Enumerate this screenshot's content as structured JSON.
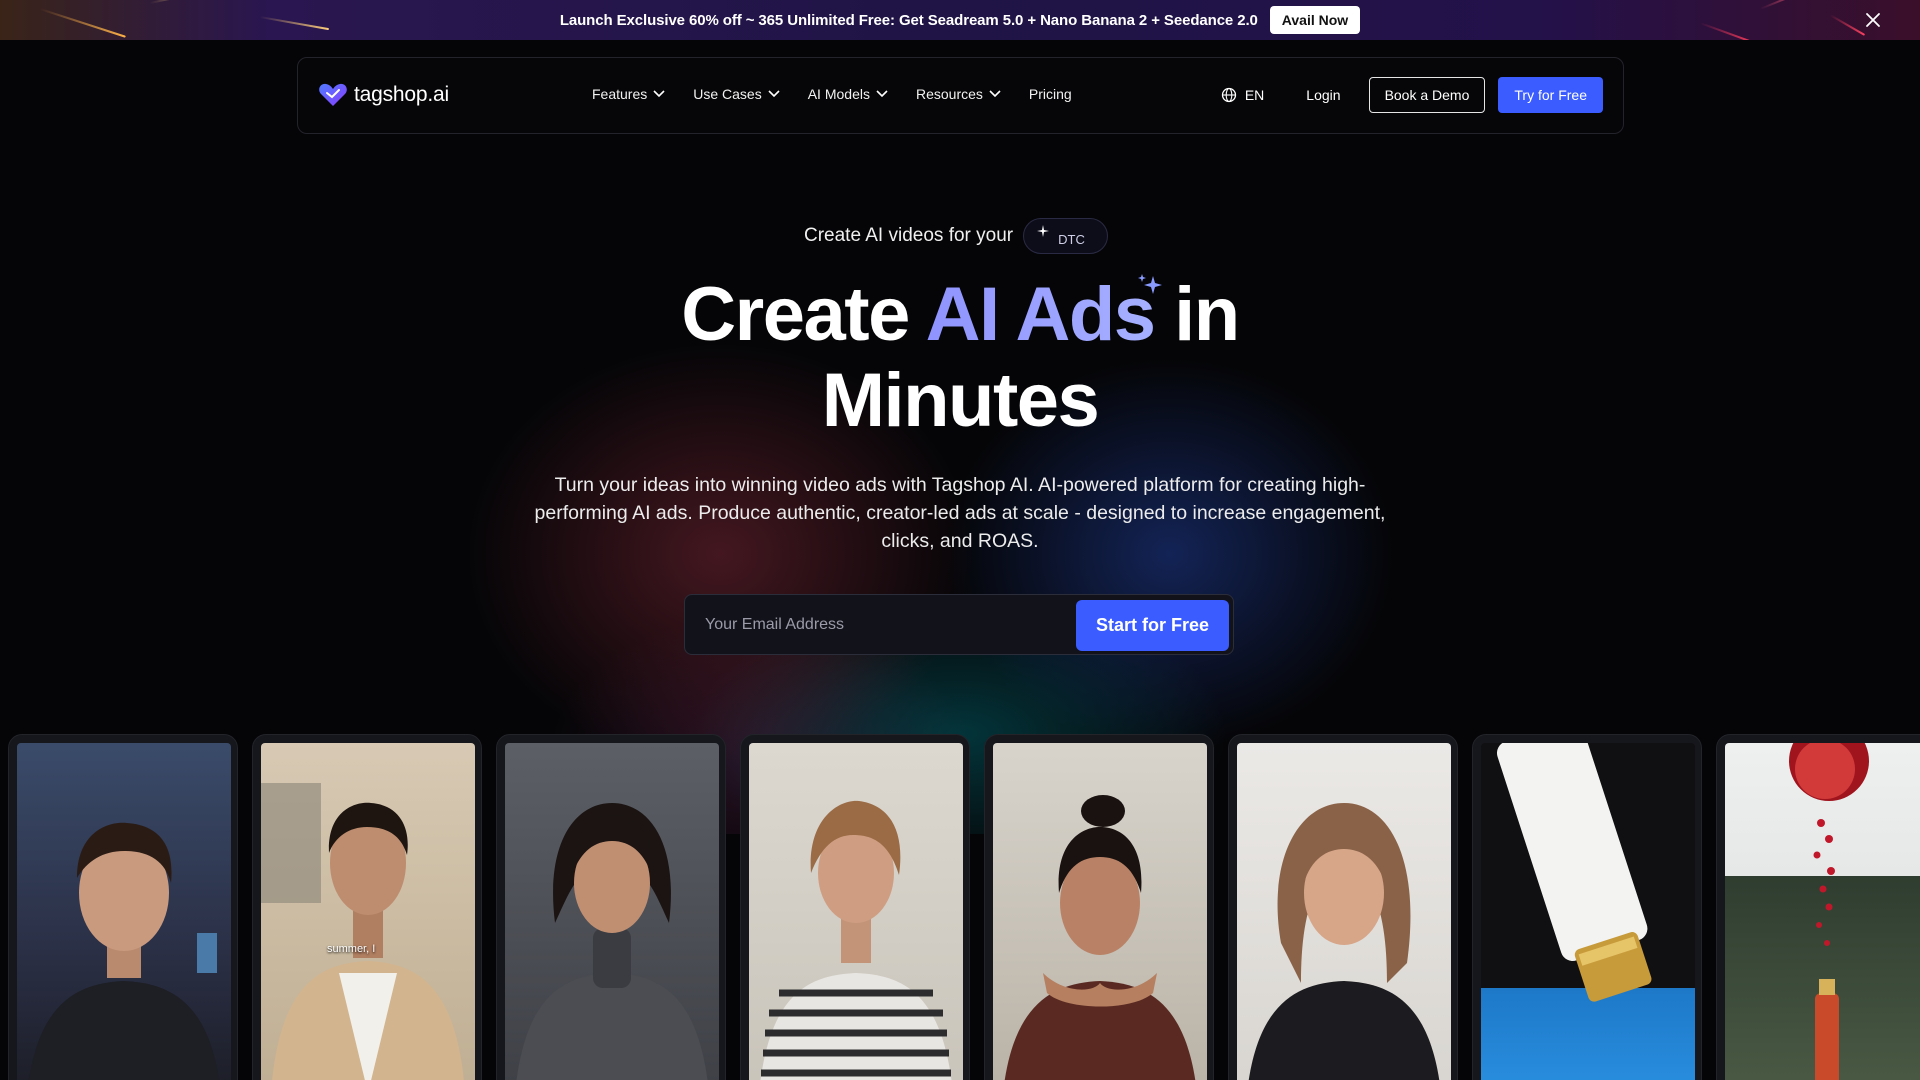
{
  "promo": {
    "text": "Launch Exclusive 60% off ~ 365 Unlimited Free: Get Seadream 5.0 + Nano Banana 2 + Seedance 2.0",
    "button": "Avail Now"
  },
  "nav": {
    "logo": "tagshop.ai",
    "links": [
      "Features",
      "Use Cases",
      "AI Models",
      "Resources",
      "Pricing"
    ],
    "language": "EN",
    "login": "Login",
    "demo": "Book a Demo",
    "try": "Try for Free"
  },
  "hero": {
    "kicker": "Create AI videos for your",
    "pill": "DTC",
    "title_before": "Create ",
    "title_accent": "AI Ads",
    "title_after": " in",
    "title_line2": "Minutes",
    "subtitle": "Turn your ideas into winning video ads with Tagshop AI. AI-powered platform for creating high-performing AI ads. Produce authentic, creator-led ads at scale - designed to increase engagement, clicks, and ROAS.",
    "email_placeholder": "Your Email Address",
    "cta": "Start for Free"
  },
  "gallery": {
    "caption": "summer, I"
  },
  "colors": {
    "accent": "#3b5cff",
    "title_accent": "#9aa0ff",
    "background": "#050507"
  }
}
